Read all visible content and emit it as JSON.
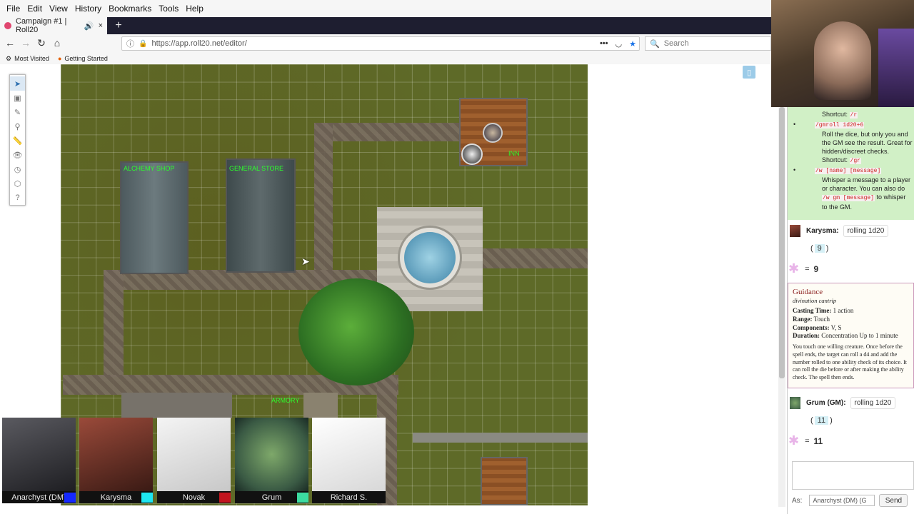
{
  "menu": [
    "File",
    "Edit",
    "View",
    "History",
    "Bookmarks",
    "Tools",
    "Help"
  ],
  "tab": {
    "title": "Campaign #1 | Roll20",
    "close": "×",
    "new_tab": "+"
  },
  "nav": {
    "url": "https://app.roll20.net/editor/",
    "search_placeholder": "Search",
    "dots": "•••"
  },
  "bookmarks": [
    "Most Visited",
    "Getting Started"
  ],
  "map": {
    "labels": {
      "alchemy": "ALCHEMY SHOP",
      "general": "GENERAL STORE",
      "inn": "INN",
      "armory": "ARMORY"
    }
  },
  "players": [
    {
      "name": "Anarchyst (DM)",
      "color": "#1428ff"
    },
    {
      "name": "Karysma",
      "color": "#1ee6f0"
    },
    {
      "name": "Novak",
      "color": "#c2141e"
    },
    {
      "name": "Grum",
      "color": "#3cdca0"
    },
    {
      "name": "Richard S.",
      "color": ""
    }
  ],
  "chat": {
    "help": {
      "shortcut1_label": "Shortcut:",
      "shortcut1_code": "/r",
      "gmroll_code": "/gmroll 1d20+6",
      "gmroll_text": "Roll the dice, but only you and the GM see the result. Great for hidden/discreet checks.",
      "shortcut2_label": "Shortcut:",
      "shortcut2_code": "/gr",
      "whisper_code": "/w [name] [message]",
      "whisper_text_1": "Whisper a message to a player or character. You can also do",
      "whisper_code_2": "/w gm [message]",
      "whisper_text_2": "to whisper to the GM."
    },
    "msg1": {
      "speaker": "Karysma:",
      "roll": "rolling 1d20",
      "die": "9",
      "result": "9"
    },
    "spell": {
      "name": "Guidance",
      "type": "divination cantrip",
      "casting_label": "Casting Time:",
      "casting": "1 action",
      "range_label": "Range:",
      "range": "Touch",
      "components_label": "Components:",
      "components": "V, S",
      "duration_label": "Duration:",
      "duration": "Concentration Up to 1 minute",
      "desc": "You touch one willing creature. Once before the spell ends, the target can roll a d4 and add the number rolled to one ability check of its choice. It can roll the die before or after making the ability check. The spell then ends."
    },
    "msg2": {
      "speaker": "Grum (GM):",
      "roll": "rolling 1d20",
      "die": "11",
      "result": "11"
    },
    "as_label": "As:",
    "as_value": "Anarchyst (DM) (G",
    "send": "Send"
  }
}
